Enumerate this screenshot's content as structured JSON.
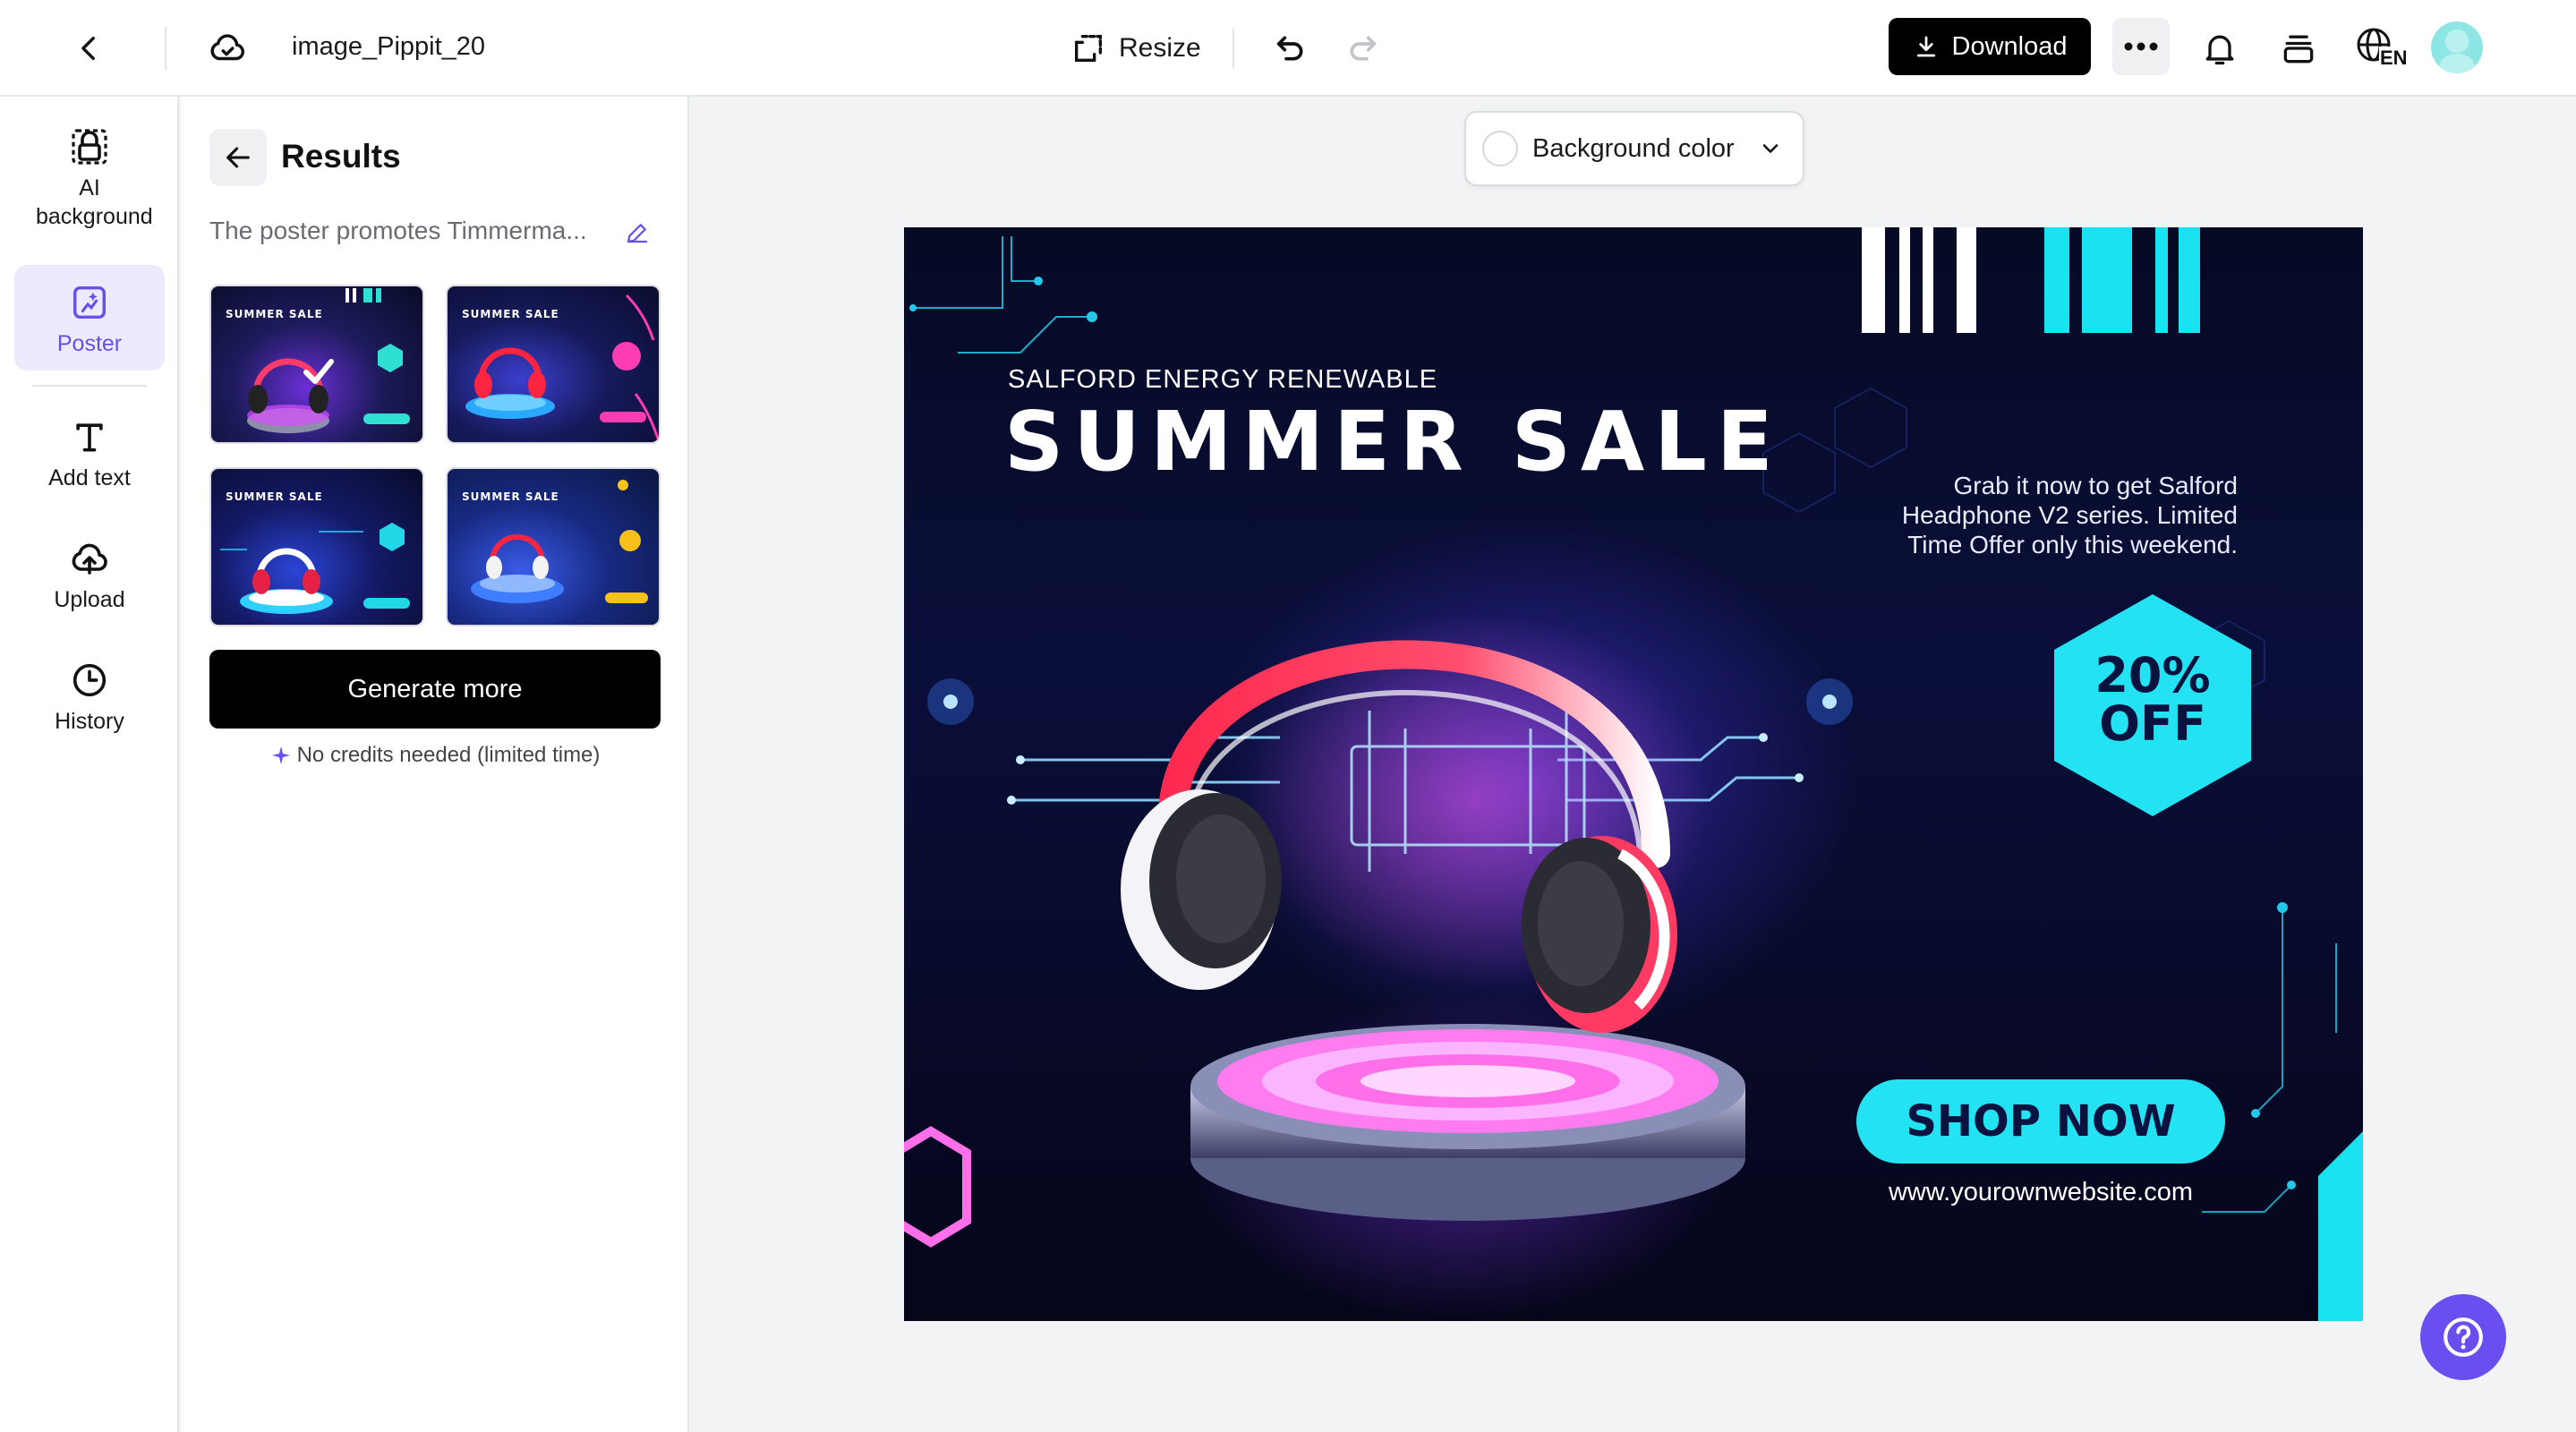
{
  "header": {
    "file_name": "image_Pippit_20",
    "resize_label": "Resize",
    "download_label": "Download",
    "language_code": "EN"
  },
  "sidebar": {
    "items": [
      {
        "label": "AI background",
        "icon": "ai-background-icon"
      },
      {
        "label": "Poster",
        "icon": "poster-icon",
        "active": true
      },
      {
        "label": "Add text",
        "icon": "text-icon"
      },
      {
        "label": "Upload",
        "icon": "upload-icon"
      },
      {
        "label": "History",
        "icon": "history-icon"
      }
    ]
  },
  "results": {
    "title": "Results",
    "prompt": "The poster promotes Timmerma...",
    "thumbnails": [
      {
        "title": "SUMMER SALE",
        "accent": "#2fe0d2"
      },
      {
        "title": "SUMMER SALE",
        "accent": "#ff3db3"
      },
      {
        "title": "SUMMER SALE",
        "accent": "#21d7e8"
      },
      {
        "title": "SUMMER SALE",
        "accent": "#f6c21a"
      }
    ],
    "generate_label": "Generate more",
    "credits_note": "No credits needed (limited time)"
  },
  "canvas": {
    "background_color_label": "Background color"
  },
  "poster": {
    "brand": "SALFORD ENERGY RENEWABLE",
    "title": "SUMMER SALE",
    "description": "Grab it now to get Salford Headphone V2 series. Limited Time Offer only this weekend.",
    "badge_line1": "20%",
    "badge_line2": "OFF",
    "cta": "SHOP NOW",
    "url": "www.yourownwebsite.com"
  },
  "colors": {
    "accent": "#6a4ef0",
    "cyan": "#23e3f2",
    "pink": "#ff3db3",
    "poster_bg": "#0a0f3a"
  }
}
